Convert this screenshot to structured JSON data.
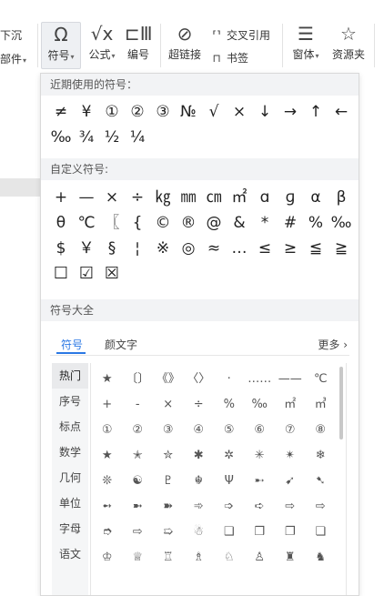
{
  "ribbon": {
    "left_top": "下沉",
    "left_bottom": "部件",
    "symbol": {
      "label": "符号",
      "icon": "omega-icon"
    },
    "formula": {
      "label": "公式",
      "icon": "formula-icon"
    },
    "numbering": {
      "label": "编号",
      "icon": "numbering-icon"
    },
    "cross_ref": {
      "label": "交叉引用",
      "icon": "cross-reference-icon"
    },
    "hyperlink": {
      "label": "超链接",
      "icon": "link-icon"
    },
    "bookmark": {
      "label": "书签",
      "icon": "bookmark-icon"
    },
    "form": {
      "label": "窗体",
      "icon": "form-icon"
    },
    "resources": {
      "label": "资源夹",
      "icon": "star-icon"
    }
  },
  "panel": {
    "recent_title": "近期使用的符号：",
    "recent": [
      [
        "≠",
        "¥",
        "①",
        "②",
        "③",
        "№",
        "√",
        "×",
        "↓",
        "→",
        "↑",
        "←"
      ],
      [
        "‰",
        "¾",
        "½",
        "¼"
      ]
    ],
    "custom_title": "自定义符号:",
    "custom": [
      [
        "+",
        "—",
        "×",
        "÷",
        "㎏",
        "㎜",
        "㎝",
        "㎡",
        "ɑ",
        "ɡ",
        "α",
        "β"
      ],
      [
        "θ",
        "℃",
        "〖",
        "{",
        "©",
        "®",
        "@",
        "&",
        "*",
        "#",
        "%",
        "‰"
      ],
      [
        "$",
        "￥",
        "§",
        "¦",
        "※",
        "◎",
        "≈",
        "…",
        "≤",
        "≥",
        "≦",
        "≧"
      ],
      [
        "☐",
        "☑",
        "☒"
      ]
    ],
    "all_title": "符号大全",
    "tabs": [
      "符号",
      "颜文字"
    ],
    "more": "更多",
    "categories": [
      "热门",
      "序号",
      "标点",
      "数学",
      "几何",
      "单位",
      "字母",
      "语文"
    ],
    "grid": [
      [
        "★",
        "〔〕",
        "《》",
        "〈〉",
        "·",
        "……",
        "——",
        "℃"
      ],
      [
        "+",
        "-",
        "×",
        "÷",
        "%",
        "‰",
        "㎡",
        "㎥"
      ],
      [
        "①",
        "②",
        "③",
        "④",
        "⑤",
        "⑥",
        "⑦",
        "⑧"
      ],
      [
        "★",
        "✭",
        "✮",
        "✱",
        "✲",
        "✳",
        "✴",
        "❄"
      ],
      [
        "❊",
        "☯",
        "♇",
        "☬",
        "Ψ",
        "➸",
        "➹",
        "➷"
      ],
      [
        "➻",
        "➼",
        "➽",
        "➾",
        "➩",
        "➪",
        "⇨",
        "⇨"
      ],
      [
        "➮",
        "⇨",
        "➯",
        "☃",
        "❑",
        "❒",
        "❐",
        "❏"
      ],
      [
        "♔",
        "♕",
        "♖",
        "♗",
        "♘",
        "♙",
        "♜",
        "♞"
      ]
    ]
  }
}
